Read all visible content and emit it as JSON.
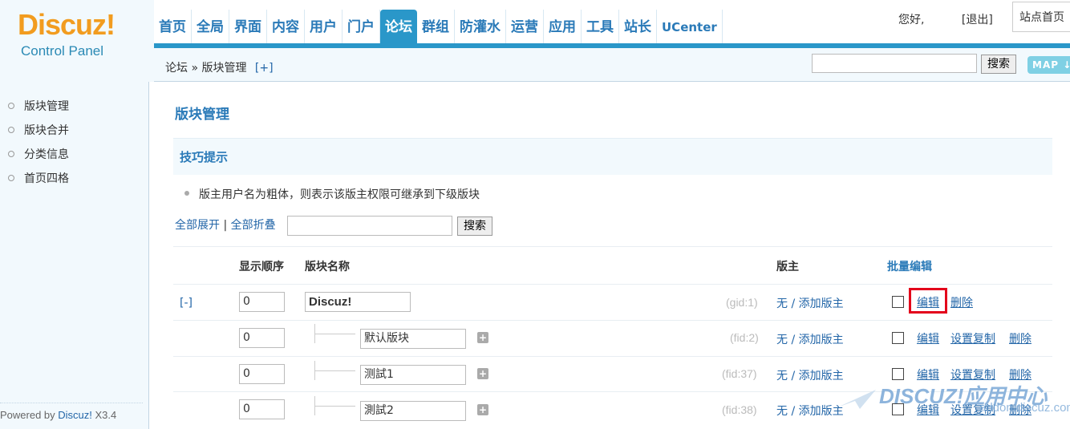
{
  "logo": {
    "brand": "Discuz!",
    "sub": "Control Panel"
  },
  "nav": {
    "items": [
      "首页",
      "全局",
      "界面",
      "内容",
      "用户",
      "门户",
      "论坛",
      "群组",
      "防灌水",
      "运营",
      "应用",
      "工具",
      "站长",
      "UCenter"
    ],
    "active_index": 6
  },
  "user": {
    "greeting": "您好,",
    "logout": "[退出]",
    "site_home": "站点首页"
  },
  "breadcrumb": {
    "text": "论坛 » 版块管理",
    "plus": "[+]"
  },
  "top_search": {
    "button": "搜索",
    "value": ""
  },
  "map_button": "MAP ↓",
  "sidebar": {
    "items": [
      "版块管理",
      "版块合并",
      "分类信息",
      "首页四格"
    ],
    "powered_prefix": "Powered by ",
    "powered_brand": "Discuz!",
    "powered_version": " X3.4"
  },
  "page_title": "版块管理",
  "tips": {
    "title": "技巧提示",
    "line": "版主用户名为粗体，则表示该版主权限可继承到下级版块"
  },
  "expand": {
    "expand_all": "全部展开",
    "sep": " | ",
    "collapse_all": "全部折叠",
    "search_button": "搜索"
  },
  "table": {
    "headers": {
      "order": "显示顺序",
      "name": "版块名称",
      "moderator": "版主",
      "batch": "批量编辑"
    },
    "group": {
      "toggle": "[-]",
      "order": "0",
      "name": "Discuz!",
      "id": "(gid:1)",
      "moderator": "无 / 添加版主",
      "edit": "编辑",
      "delete": "删除"
    },
    "forums": [
      {
        "order": "0",
        "name": "默认版块",
        "id": "(fid:2)",
        "moderator": "无 / 添加版主",
        "edit": "编辑",
        "copy": "设置复制",
        "delete": "删除"
      },
      {
        "order": "0",
        "name": "测試1",
        "id": "(fid:37)",
        "moderator": "无 / 添加版主",
        "edit": "编辑",
        "copy": "设置复制",
        "delete": "删除"
      },
      {
        "order": "0",
        "name": "測試2",
        "id": "(fid:38)",
        "moderator": "无 / 添加版主",
        "edit": "编辑",
        "copy": "设置复制",
        "delete": "删除"
      }
    ]
  },
  "watermark": {
    "brand": "DISCUZ!应用中心",
    "url": "addon.discuz.com"
  },
  "colors": {
    "accent": "#2a97c9",
    "link": "#2366a8",
    "highlight": "#e3001b",
    "logo_orange": "#f29c1f"
  }
}
